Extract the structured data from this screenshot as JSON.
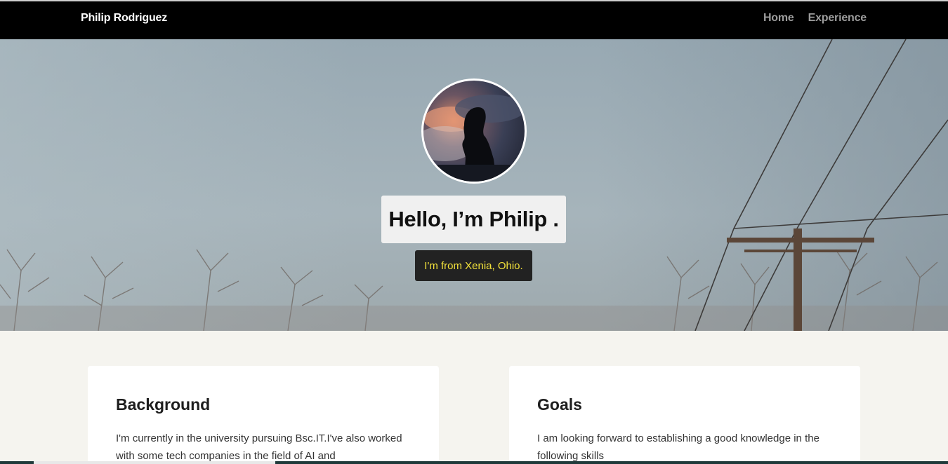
{
  "navbar": {
    "brand": "Philip Rodriguez",
    "links": [
      "Home",
      "Experience"
    ]
  },
  "hero": {
    "title": "Hello, I’m Philip .",
    "subtitle": "I'm from Xenia, Ohio."
  },
  "cards": [
    {
      "title": "Background",
      "text": "I'm currently in the university pursuing Bsc.IT.I've also worked with some tech companies in the field of AI and"
    },
    {
      "title": "Goals",
      "text": "I am looking forward to establishing a good knowledge in the following skills"
    }
  ],
  "colors": {
    "navbar": "#000000",
    "subtitle_text": "#f3e23b",
    "page_background": "#f5f4ef"
  }
}
